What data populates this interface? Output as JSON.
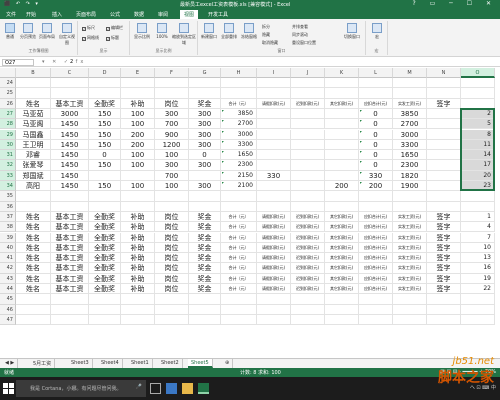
{
  "window": {
    "title": "最新员工excel工资表模板.xls [兼容模式] - Excel",
    "quick_access": "⬛ ↶ ↷ ▾",
    "controls": "? ▭ ─ ☐ ✕"
  },
  "ribbon_tabs": [
    "文件",
    "开始",
    "插入",
    "页面布局",
    "公式",
    "数据",
    "审阅",
    "视图",
    "开发工具"
  ],
  "active_tab_index": 7,
  "ribbon": {
    "groups": [
      {
        "label": "工作簿视图",
        "buttons": [
          "普通",
          "分页预览",
          "页面布局",
          "自定义视图"
        ]
      },
      {
        "label": "显示",
        "checks": [
          {
            "label": "标尺",
            "checked": true
          },
          {
            "label": "编辑栏",
            "checked": true
          },
          {
            "label": "网格线",
            "checked": true
          },
          {
            "label": "标题",
            "checked": true
          }
        ]
      },
      {
        "label": "显示比例",
        "buttons": [
          "显示比例",
          "100%",
          "缩放到选定区域"
        ]
      },
      {
        "label": "窗口",
        "buttons": [
          "新建窗口",
          "全部重排",
          "冻结窗格",
          "拆分",
          "隐藏",
          "取消隐藏",
          "并排查看",
          "同步滚动",
          "重设窗口位置",
          "切换窗口"
        ]
      },
      {
        "label": "宏",
        "buttons": [
          "宏"
        ]
      }
    ]
  },
  "formula_bar": {
    "name_box": "O27",
    "icons": "▾ ✕ ✓ fx",
    "value": "2"
  },
  "columns": [
    "B",
    "C",
    "D",
    "E",
    "F",
    "G",
    "H",
    "I",
    "J",
    "K",
    "L",
    "M",
    "N",
    "O"
  ],
  "selected_column": "O",
  "header_row": [
    "姓名",
    "基本工资",
    "全勤奖",
    "补助",
    "岗位",
    "奖金",
    "合计（元）",
    "请假扣款(元)",
    "迟到扣款(元)",
    "其它扣款(元)",
    "应扣合计(元)",
    "实发工资(元)",
    "签字",
    ""
  ],
  "rows": [
    {
      "num": "24",
      "cells": [
        "",
        "",
        "",
        "",
        "",
        "",
        "",
        "",
        "",
        "",
        "",
        "",
        "",
        ""
      ]
    },
    {
      "num": "25",
      "cells": [
        "",
        "",
        "",
        "",
        "",
        "",
        "",
        "",
        "",
        "",
        "",
        "",
        "",
        ""
      ]
    },
    {
      "num": "26",
      "cells": [
        "姓名",
        "基本工资",
        "全勤奖",
        "补助",
        "岗位",
        "奖金",
        "合计（元）",
        "请假扣款(元)",
        "迟到扣款(元)",
        "其它扣款(元)",
        "应扣合计(元)",
        "实发工资(元)",
        "签字",
        ""
      ]
    },
    {
      "num": "27",
      "cells": [
        "马亚茹",
        "3000",
        "150",
        "100",
        "300",
        "300",
        "3850",
        "",
        "",
        "",
        "0",
        "3850",
        "",
        "2"
      ]
    },
    {
      "num": "28",
      "cells": [
        "马亚阁",
        "1450",
        "150",
        "100",
        "700",
        "300",
        "2700",
        "",
        "",
        "",
        "0",
        "2700",
        "",
        "5"
      ]
    },
    {
      "num": "29",
      "cells": [
        "马国鑫",
        "1450",
        "150",
        "200",
        "900",
        "300",
        "3000",
        "",
        "",
        "",
        "0",
        "3000",
        "",
        "8"
      ]
    },
    {
      "num": "30",
      "cells": [
        "王卫明",
        "1450",
        "150",
        "200",
        "1200",
        "300",
        "3300",
        "",
        "",
        "",
        "0",
        "3300",
        "",
        "11"
      ]
    },
    {
      "num": "31",
      "cells": [
        "邓睿",
        "1450",
        "0",
        "100",
        "100",
        "0",
        "1650",
        "",
        "",
        "",
        "0",
        "1650",
        "",
        "14"
      ]
    },
    {
      "num": "32",
      "cells": [
        "张爱琴",
        "1450",
        "150",
        "100",
        "300",
        "300",
        "2300",
        "",
        "",
        "",
        "0",
        "2300",
        "",
        "17"
      ]
    },
    {
      "num": "33",
      "cells": [
        "郑国斌",
        "1450",
        "",
        "",
        "700",
        "",
        "2150",
        "330",
        "",
        "",
        "330",
        "1820",
        "",
        "20"
      ]
    },
    {
      "num": "34",
      "cells": [
        "高阳",
        "1450",
        "150",
        "100",
        "100",
        "300",
        "2100",
        "",
        "",
        "200",
        "200",
        "1900",
        "",
        "23"
      ]
    },
    {
      "num": "35",
      "cells": [
        "",
        "",
        "",
        "",
        "",
        "",
        "",
        "",
        "",
        "",
        "",
        "",
        "",
        ""
      ]
    },
    {
      "num": "36",
      "cells": [
        "",
        "",
        "",
        "",
        "",
        "",
        "",
        "",
        "",
        "",
        "",
        "",
        "",
        ""
      ]
    },
    {
      "num": "37",
      "cells": [
        "姓名",
        "基本工资",
        "全勤奖",
        "补助",
        "岗位",
        "奖金",
        "合计（元）",
        "请假扣款(元)",
        "迟到扣款(元)",
        "其它扣款(元)",
        "应扣合计(元)",
        "实发工资(元)",
        "签字",
        "1"
      ]
    },
    {
      "num": "38",
      "cells": [
        "姓名",
        "基本工资",
        "全勤奖",
        "补助",
        "岗位",
        "奖金",
        "合计（元）",
        "请假扣款(元)",
        "迟到扣款(元)",
        "其它扣款(元)",
        "应扣合计(元)",
        "实发工资(元)",
        "签字",
        "4"
      ]
    },
    {
      "num": "39",
      "cells": [
        "姓名",
        "基本工资",
        "全勤奖",
        "补助",
        "岗位",
        "奖金",
        "合计（元）",
        "请假扣款(元)",
        "迟到扣款(元)",
        "其它扣款(元)",
        "应扣合计(元)",
        "实发工资(元)",
        "签字",
        "7"
      ]
    },
    {
      "num": "40",
      "cells": [
        "姓名",
        "基本工资",
        "全勤奖",
        "补助",
        "岗位",
        "奖金",
        "合计（元）",
        "请假扣款(元)",
        "迟到扣款(元)",
        "其它扣款(元)",
        "应扣合计(元)",
        "实发工资(元)",
        "签字",
        "10"
      ]
    },
    {
      "num": "41",
      "cells": [
        "姓名",
        "基本工资",
        "全勤奖",
        "补助",
        "岗位",
        "奖金",
        "合计（元）",
        "请假扣款(元)",
        "迟到扣款(元)",
        "其它扣款(元)",
        "应扣合计(元)",
        "实发工资(元)",
        "签字",
        "13"
      ]
    },
    {
      "num": "42",
      "cells": [
        "姓名",
        "基本工资",
        "全勤奖",
        "补助",
        "岗位",
        "奖金",
        "合计（元）",
        "请假扣款(元)",
        "迟到扣款(元)",
        "其它扣款(元)",
        "应扣合计(元)",
        "实发工资(元)",
        "签字",
        "16"
      ]
    },
    {
      "num": "43",
      "cells": [
        "姓名",
        "基本工资",
        "全勤奖",
        "补助",
        "岗位",
        "奖金",
        "合计（元）",
        "请假扣款(元)",
        "迟到扣款(元)",
        "其它扣款(元)",
        "应扣合计(元)",
        "实发工资(元)",
        "签字",
        "19"
      ]
    },
    {
      "num": "44",
      "cells": [
        "姓名",
        "基本工资",
        "全勤奖",
        "补助",
        "岗位",
        "奖金",
        "合计（元）",
        "请假扣款(元)",
        "迟到扣款(元)",
        "其它扣款(元)",
        "应扣合计(元)",
        "实发工资(元)",
        "签字",
        "22"
      ]
    },
    {
      "num": "45",
      "cells": [
        "",
        "",
        "",
        "",
        "",
        "",
        "",
        "",
        "",
        "",
        "",
        "",
        "",
        ""
      ]
    },
    {
      "num": "46",
      "cells": [
        "",
        "",
        "",
        "",
        "",
        "",
        "",
        "",
        "",
        "",
        "",
        "",
        "",
        ""
      ]
    },
    {
      "num": "47",
      "cells": [
        "",
        "",
        "",
        "",
        "",
        "",
        "",
        "",
        "",
        "",
        "",
        "",
        "",
        ""
      ]
    }
  ],
  "sheet_tabs": [
    "5月工资",
    "Sheet3",
    "Sheet4",
    "Sheet1",
    "Sheet2",
    "Sheet5"
  ],
  "active_sheet_index": 5,
  "statusbar": {
    "left": "就绪",
    "mid": "计数: 8   求和: 100",
    "right": "▦ ▣ ▤  - ━━━━━ +  70%"
  },
  "taskbar": {
    "search_placeholder": "我是 Cortana，小娜。有问题尽管问我。",
    "tray": "へ ⊡ ⌨ 中"
  },
  "watermark": {
    "site": "jb51.net",
    "name": "脚本之家"
  },
  "colors": {
    "accent": "#217346",
    "selection": "#d9d9d9"
  }
}
